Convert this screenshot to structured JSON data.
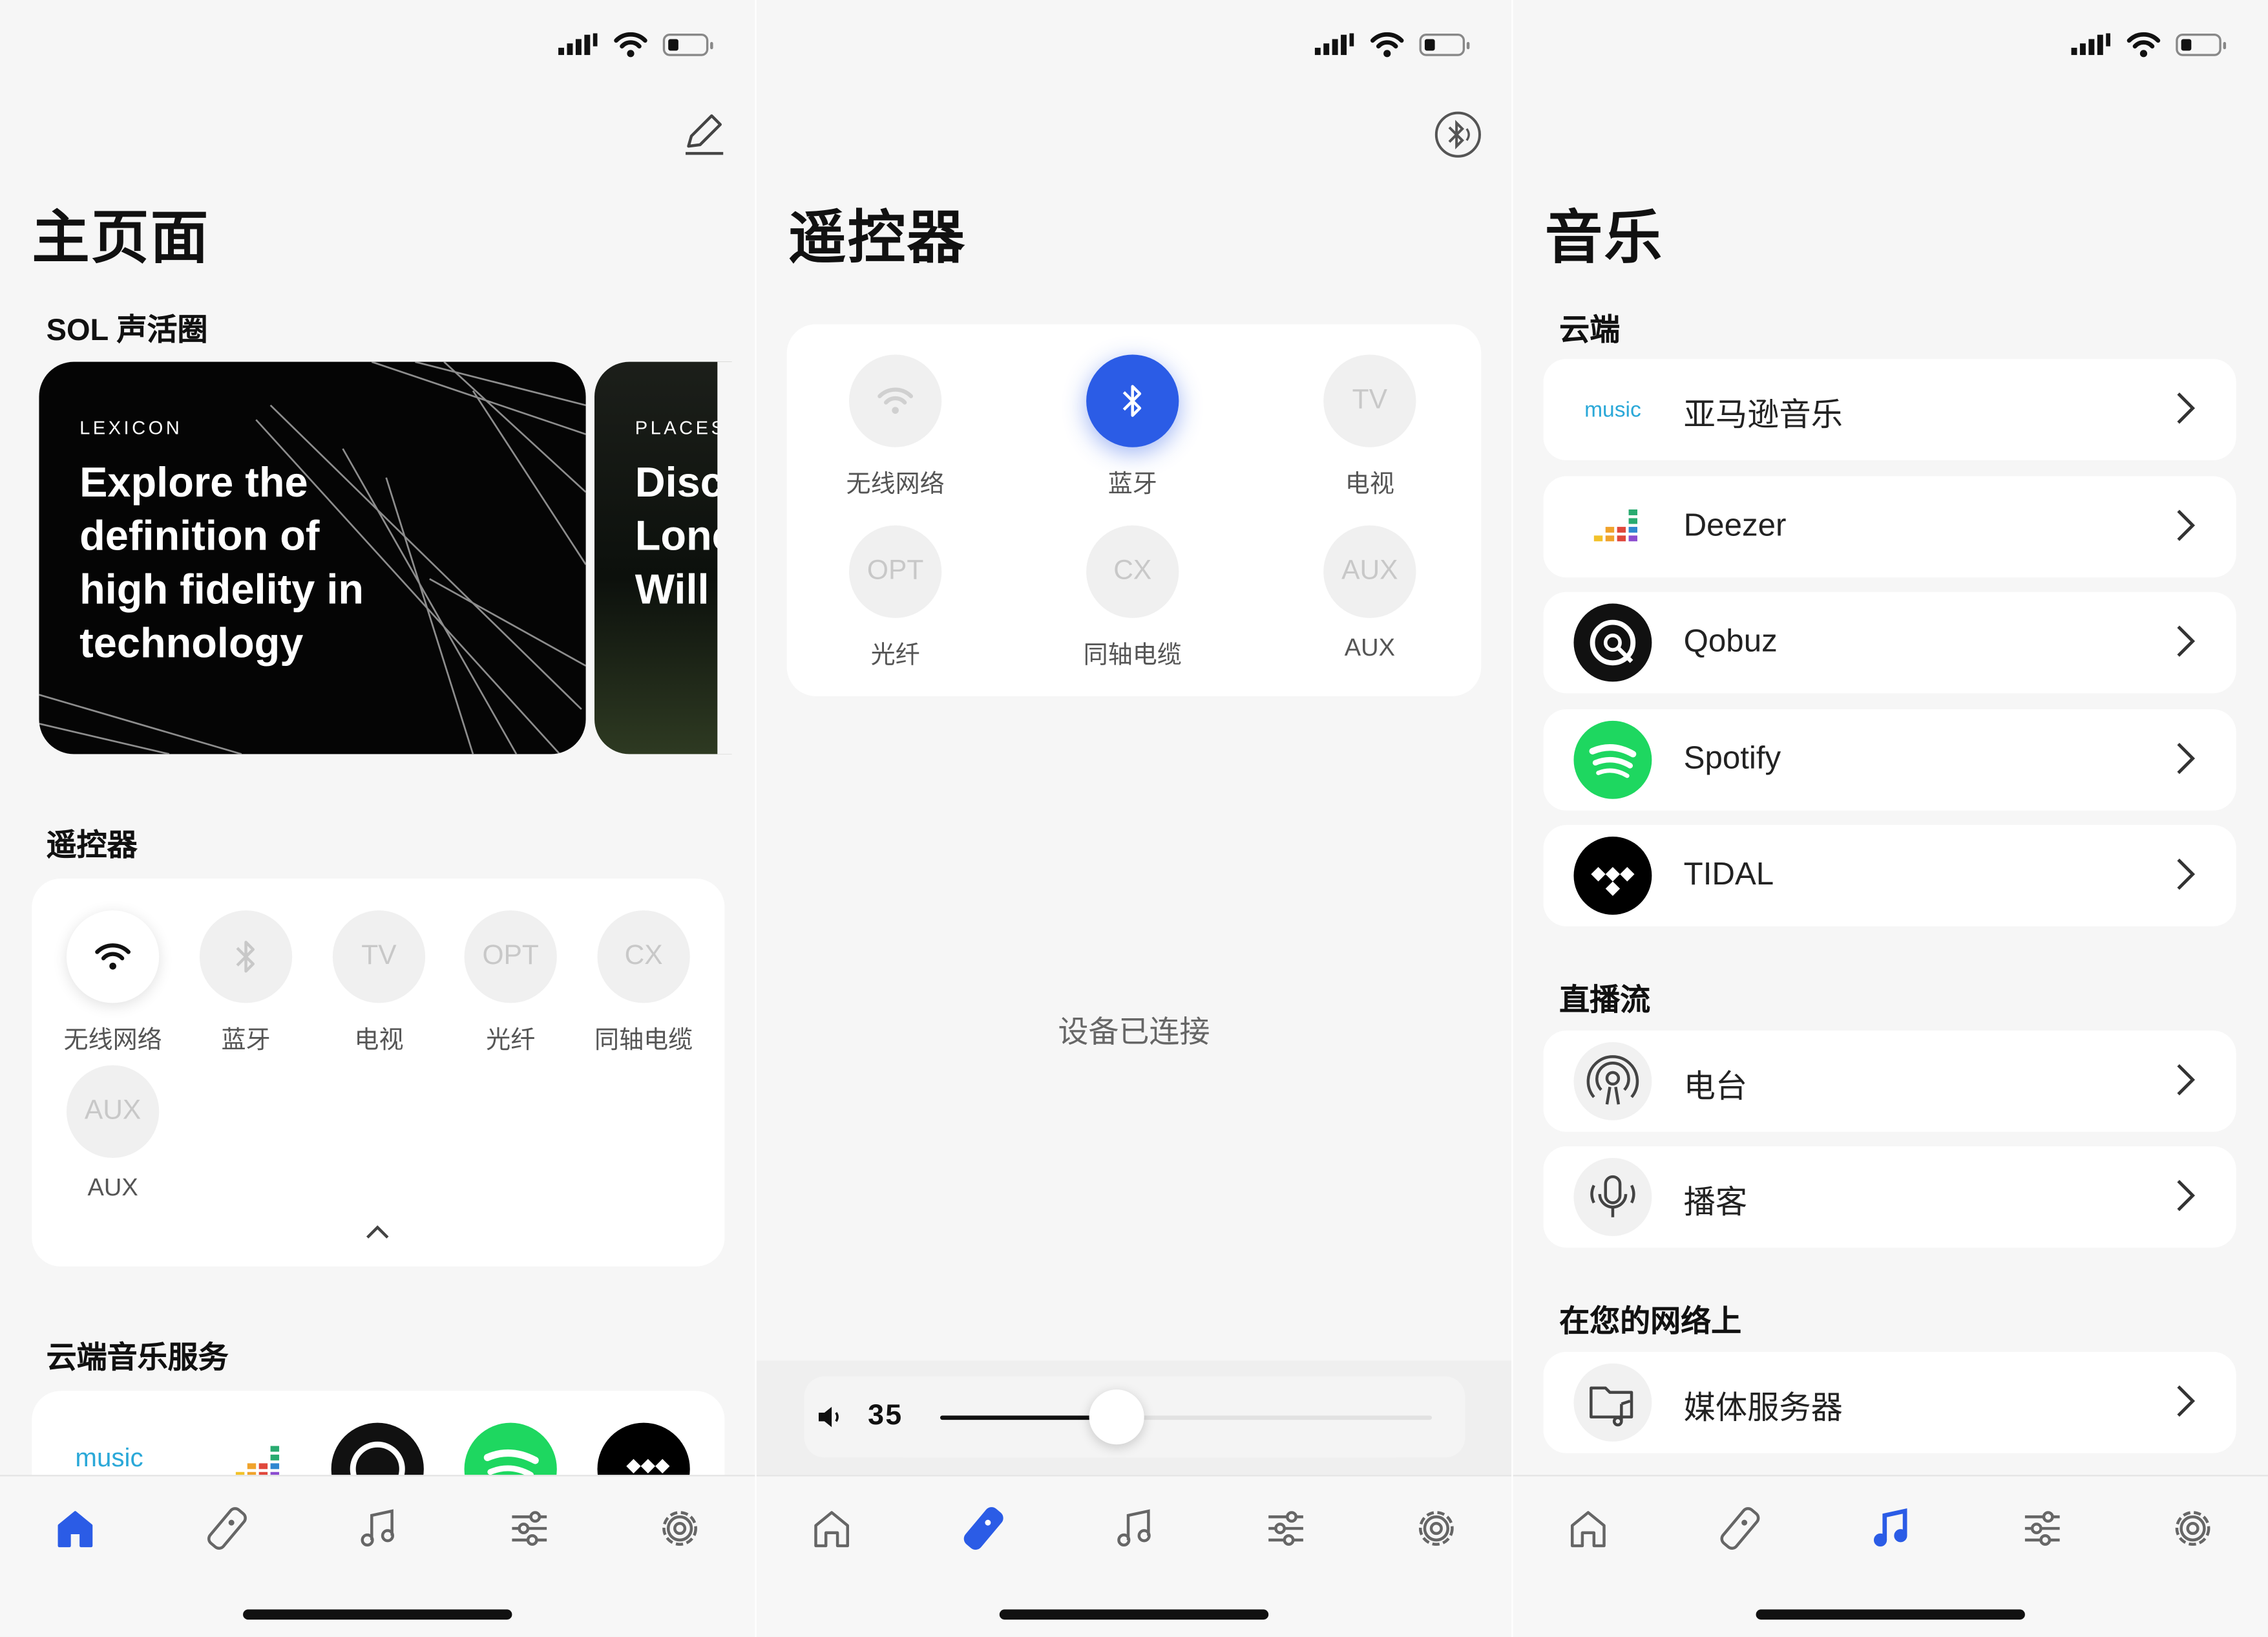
{
  "colors": {
    "accent": "#2b5ce6",
    "bg": "#f6f6f6",
    "card": "#ffffff",
    "spotify": "#1ed760"
  },
  "home": {
    "title": "主页面",
    "section_sol": "SOL 声活圈",
    "promo_cards": [
      {
        "brand": "LEXICON",
        "headline": "Explore the definition of high fidelity in technology"
      },
      {
        "brand": "PLACES",
        "headline": "Disc Lonc Will"
      }
    ],
    "section_remote": "遥控器",
    "sources": [
      {
        "label": "无线网络",
        "icon": "wifi-icon",
        "active": true
      },
      {
        "label": "蓝牙",
        "icon": "bluetooth-icon",
        "active": false
      },
      {
        "label": "电视",
        "icon_text": "TV",
        "active": false
      },
      {
        "label": "光纤",
        "icon_text": "OPT",
        "active": false
      },
      {
        "label": "同轴电缆",
        "icon_text": "CX",
        "active": false
      },
      {
        "label": "AUX",
        "icon_text": "AUX",
        "active": false
      }
    ],
    "section_cloud": "云端音乐服务",
    "cloud_icons": [
      "amazon-music-icon",
      "deezer-icon",
      "qobuz-icon",
      "spotify-icon",
      "tidal-icon"
    ],
    "amazon_text": "music"
  },
  "remote": {
    "title": "遥控器",
    "sources": [
      {
        "label": "无线网络",
        "icon": "wifi-icon",
        "active": false
      },
      {
        "label": "蓝牙",
        "icon": "bluetooth-icon",
        "active": true
      },
      {
        "label": "电视",
        "icon_text": "TV",
        "active": false
      },
      {
        "label": "光纤",
        "icon_text": "OPT",
        "active": false
      },
      {
        "label": "同轴电缆",
        "icon_text": "CX",
        "active": false
      },
      {
        "label": "AUX",
        "icon_text": "AUX",
        "active": false
      }
    ],
    "status": "设备已连接",
    "volume": {
      "value": "35",
      "level": 0.36
    }
  },
  "music": {
    "title": "音乐",
    "section_cloud": "云端",
    "cloud": [
      {
        "label": "亚马逊音乐",
        "icon": "amazon-music-icon",
        "icon_text": "music"
      },
      {
        "label": "Deezer",
        "icon": "deezer-icon"
      },
      {
        "label": "Qobuz",
        "icon": "qobuz-icon"
      },
      {
        "label": "Spotify",
        "icon": "spotify-icon"
      },
      {
        "label": "TIDAL",
        "icon": "tidal-icon"
      }
    ],
    "section_live": "直播流",
    "live": [
      {
        "label": "电台",
        "icon": "radio-icon"
      },
      {
        "label": "播客",
        "icon": "podcast-icon"
      }
    ],
    "section_network": "在您的网络上",
    "network": [
      {
        "label": "媒体服务器",
        "icon": "media-server-icon"
      }
    ]
  },
  "tabs": [
    "home-tab",
    "remote-tab",
    "music-tab",
    "eq-tab",
    "settings-tab"
  ],
  "active_tabs": {
    "home": 0,
    "remote": 1,
    "music": 2
  }
}
